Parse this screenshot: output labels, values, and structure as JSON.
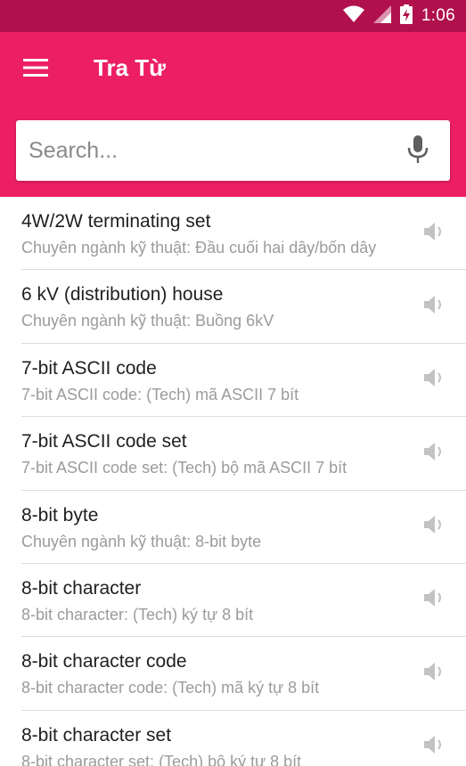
{
  "status_bar": {
    "time": "1:06",
    "icons": [
      "wifi-icon",
      "signal-icon",
      "battery-charging-icon"
    ]
  },
  "app_bar": {
    "title": "Tra Từ",
    "menu_icon": "menu-icon",
    "background": "#ec1f65",
    "status_background": "#b0114d"
  },
  "search": {
    "placeholder": "Search...",
    "value": "",
    "voice_icon": "mic-icon"
  },
  "words": [
    {
      "term": "4W/2W terminating set",
      "definition": "Chuyên ngành kỹ thuật: Đầu cuối hai dây/bốn dây"
    },
    {
      "term": "6 kV (distribution) house",
      "definition": "Chuyên ngành kỹ thuật: Buồng 6kV"
    },
    {
      "term": "7-bit ASCII code",
      "definition": "7-bit ASCII code: (Tech) mã ASCII 7 bít"
    },
    {
      "term": "7-bit ASCII code set",
      "definition": "7-bit ASCII code set: (Tech) bộ mã ASCII 7 bít"
    },
    {
      "term": "8-bit byte",
      "definition": "Chuyên ngành kỹ thuật: 8-bit byte"
    },
    {
      "term": "8-bit character",
      "definition": "8-bit character: (Tech) ký tự 8 bít"
    },
    {
      "term": "8-bit character code",
      "definition": "8-bit character code: (Tech) mã ký tự 8 bít"
    },
    {
      "term": "8-bit character set",
      "definition": "8-bit character set: (Tech) bộ ký tự 8 bít"
    }
  ]
}
